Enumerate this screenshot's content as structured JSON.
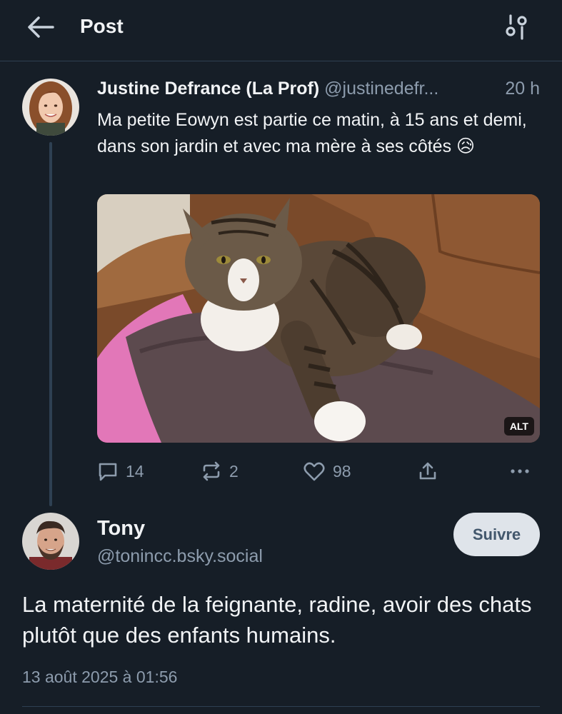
{
  "header": {
    "title": "Post"
  },
  "parent_post": {
    "author_name": "Justine Defrance (La Prof)",
    "author_handle": "@justinedefr...",
    "time": "20 h",
    "text": "Ma petite Eowyn est partie ce matin, à 15 ans et demi, dans son jardin et avec ma mère à ses côtés 😥",
    "media_alt_badge": "ALT",
    "stats": {
      "replies": "14",
      "reposts": "2",
      "likes": "98"
    }
  },
  "reply_post": {
    "author_name": "Tony",
    "author_handle": "@tonincc.bsky.social",
    "follow_label": "Suivre",
    "text": "La maternité de la feignante, radine, avoir des chats plutôt que des enfants humains.",
    "date": "13 août 2025 à 01:56"
  },
  "colors": {
    "background": "#161e27",
    "divider": "#2e4052",
    "text_primary": "#f1f3f5",
    "text_secondary": "#8d9cad",
    "follow_button_bg": "#dfe4ea",
    "follow_button_text": "#42576c"
  },
  "icons": {
    "back": "arrow-left-icon",
    "settings": "sliders-icon",
    "reply": "speech-bubble-icon",
    "repost": "repost-arrows-icon",
    "like": "heart-icon",
    "share": "share-upload-icon",
    "more": "ellipsis-icon"
  }
}
